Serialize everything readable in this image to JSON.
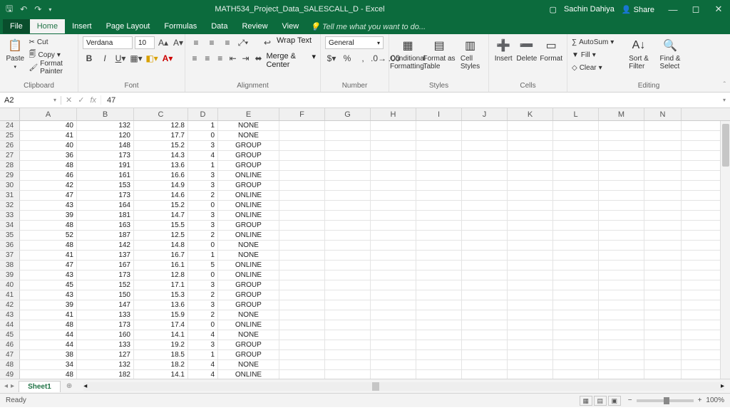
{
  "titlebar": {
    "title": "MATH534_Project_Data_SALESCALL_D - Excel",
    "user": "Sachin Dahiya",
    "share": "Share"
  },
  "tabs": [
    "File",
    "Home",
    "Insert",
    "Page Layout",
    "Formulas",
    "Data",
    "Review",
    "View"
  ],
  "tell": "Tell me what you want to do...",
  "ribbon": {
    "clipboard": {
      "paste": "Paste",
      "cut": "Cut",
      "copy": "Copy",
      "fp": "Format Painter",
      "label": "Clipboard"
    },
    "font": {
      "name": "Verdana",
      "size": "10",
      "label": "Font"
    },
    "alignment": {
      "wrap": "Wrap Text",
      "merge": "Merge & Center",
      "label": "Alignment"
    },
    "number": {
      "fmt": "General",
      "label": "Number"
    },
    "styles": {
      "cf": "Conditional\nFormatting",
      "fat": "Format as\nTable",
      "cs": "Cell\nStyles",
      "label": "Styles"
    },
    "cells": {
      "ins": "Insert",
      "del": "Delete",
      "fmt": "Format",
      "label": "Cells"
    },
    "editing": {
      "sum": "AutoSum",
      "fill": "Fill",
      "clear": "Clear",
      "sort": "Sort &\nFilter",
      "find": "Find &\nSelect",
      "label": "Editing"
    }
  },
  "fx": {
    "name": "A2",
    "value": "47"
  },
  "cols": [
    "A",
    "B",
    "C",
    "D",
    "E",
    "F",
    "G",
    "H",
    "I",
    "J",
    "K",
    "L",
    "M",
    "N"
  ],
  "rows": [
    {
      "n": 24,
      "v": [
        "40",
        "132",
        "12.8",
        "1",
        "NONE"
      ]
    },
    {
      "n": 25,
      "v": [
        "41",
        "120",
        "17.7",
        "0",
        "NONE"
      ]
    },
    {
      "n": 26,
      "v": [
        "40",
        "148",
        "15.2",
        "3",
        "GROUP"
      ]
    },
    {
      "n": 27,
      "v": [
        "36",
        "173",
        "14.3",
        "4",
        "GROUP"
      ]
    },
    {
      "n": 28,
      "v": [
        "48",
        "191",
        "13.6",
        "1",
        "GROUP"
      ]
    },
    {
      "n": 29,
      "v": [
        "46",
        "161",
        "16.6",
        "3",
        "ONLINE"
      ]
    },
    {
      "n": 30,
      "v": [
        "42",
        "153",
        "14.9",
        "3",
        "GROUP"
      ]
    },
    {
      "n": 31,
      "v": [
        "47",
        "173",
        "14.6",
        "2",
        "ONLINE"
      ]
    },
    {
      "n": 32,
      "v": [
        "43",
        "164",
        "15.2",
        "0",
        "ONLINE"
      ]
    },
    {
      "n": 33,
      "v": [
        "39",
        "181",
        "14.7",
        "3",
        "ONLINE"
      ]
    },
    {
      "n": 34,
      "v": [
        "48",
        "163",
        "15.5",
        "3",
        "GROUP"
      ]
    },
    {
      "n": 35,
      "v": [
        "52",
        "187",
        "12.5",
        "2",
        "ONLINE"
      ]
    },
    {
      "n": 36,
      "v": [
        "48",
        "142",
        "14.8",
        "0",
        "NONE"
      ]
    },
    {
      "n": 37,
      "v": [
        "41",
        "137",
        "16.7",
        "1",
        "NONE"
      ]
    },
    {
      "n": 38,
      "v": [
        "47",
        "167",
        "16.1",
        "5",
        "ONLINE"
      ]
    },
    {
      "n": 39,
      "v": [
        "43",
        "173",
        "12.8",
        "0",
        "ONLINE"
      ]
    },
    {
      "n": 40,
      "v": [
        "45",
        "152",
        "17.1",
        "3",
        "GROUP"
      ]
    },
    {
      "n": 41,
      "v": [
        "43",
        "150",
        "15.3",
        "2",
        "GROUP"
      ]
    },
    {
      "n": 42,
      "v": [
        "39",
        "147",
        "13.6",
        "3",
        "GROUP"
      ]
    },
    {
      "n": 43,
      "v": [
        "41",
        "133",
        "15.9",
        "2",
        "NONE"
      ]
    },
    {
      "n": 44,
      "v": [
        "48",
        "173",
        "17.4",
        "0",
        "ONLINE"
      ]
    },
    {
      "n": 45,
      "v": [
        "44",
        "160",
        "14.1",
        "4",
        "NONE"
      ]
    },
    {
      "n": 46,
      "v": [
        "44",
        "133",
        "19.2",
        "3",
        "GROUP"
      ]
    },
    {
      "n": 47,
      "v": [
        "38",
        "127",
        "18.5",
        "1",
        "GROUP"
      ]
    },
    {
      "n": 48,
      "v": [
        "34",
        "132",
        "18.2",
        "4",
        "NONE"
      ]
    },
    {
      "n": 49,
      "v": [
        "48",
        "182",
        "14.1",
        "4",
        "ONLINE"
      ]
    }
  ],
  "sheettab": "Sheet1",
  "status": {
    "ready": "Ready",
    "zoom": "100%"
  }
}
